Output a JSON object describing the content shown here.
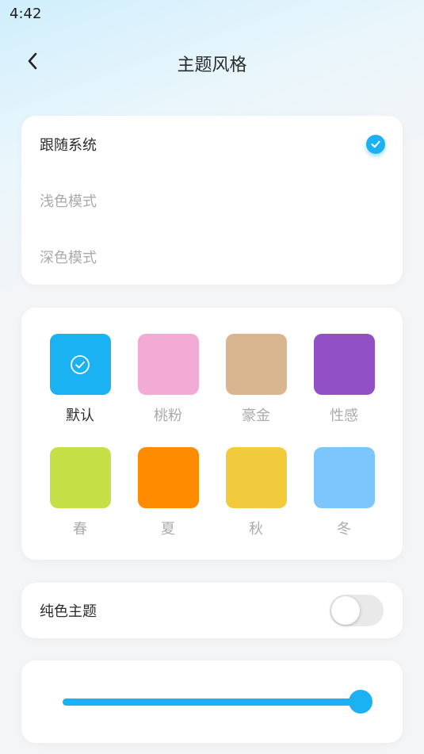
{
  "status_bar": {
    "time": "4:42"
  },
  "header": {
    "title": "主题风格",
    "back_icon": "chevron-left-icon"
  },
  "theme_modes": {
    "selected": 0,
    "items": [
      {
        "label": "跟随系统"
      },
      {
        "label": "浅色模式"
      },
      {
        "label": "深色模式"
      }
    ]
  },
  "color_themes": {
    "selected": 0,
    "items": [
      {
        "label": "默认",
        "color": "#1ab2f3"
      },
      {
        "label": "桃粉",
        "color": "#f2abd5"
      },
      {
        "label": "豪金",
        "color": "#dab690"
      },
      {
        "label": "性感",
        "color": "#9151c4"
      },
      {
        "label": "春",
        "color": "#c5e046"
      },
      {
        "label": "夏",
        "color": "#ff8c00"
      },
      {
        "label": "秋",
        "color": "#f2cb3c"
      },
      {
        "label": "冬",
        "color": "#7cc5fd"
      }
    ]
  },
  "solid_theme": {
    "label": "纯色主题",
    "enabled": false
  },
  "slider": {
    "value": 1.0
  },
  "colors": {
    "accent": "#1ab2f3"
  }
}
